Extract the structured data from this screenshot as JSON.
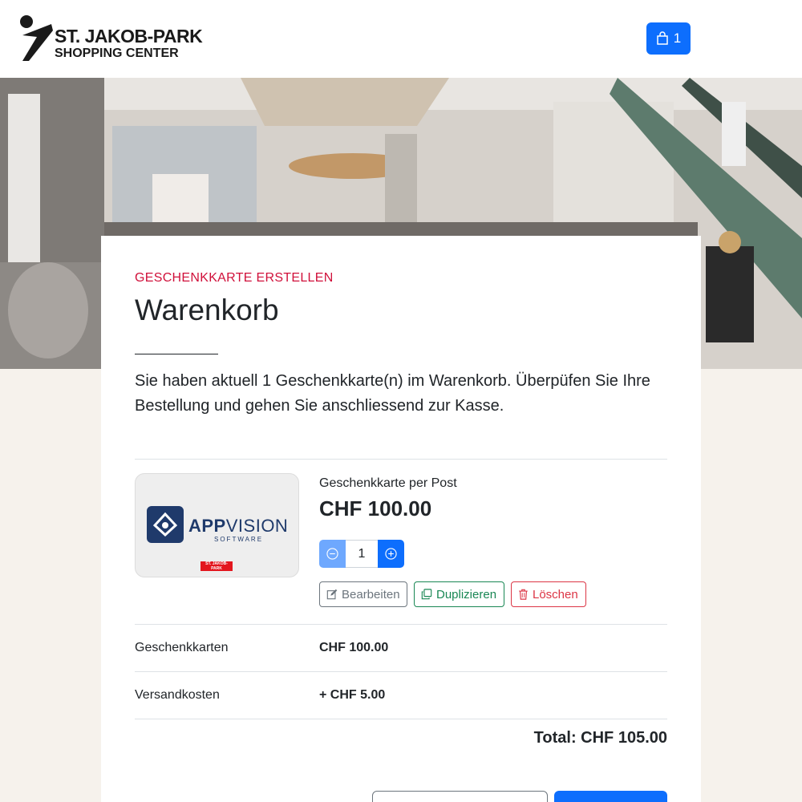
{
  "header": {
    "logo_line1": "ST. JAKOB-PARK",
    "logo_line2": "SHOPPING CENTER",
    "cart_icon": "shopping-bag-icon",
    "cart_count": "1"
  },
  "page": {
    "eyebrow": "GESCHENKKARTE ERSTELLEN",
    "title": "Warenkorb",
    "intro": "Sie haben aktuell 1 Geschenkkarte(n) im Warenkorb. Überpüfen Sie Ihre Bestellung und gehen Sie anschliessend zur Kasse."
  },
  "item": {
    "thumb_brand": "APP",
    "thumb_brand_thin": "VISION",
    "thumb_sub": "SOFTWARE",
    "thumb_badge": "ST. JAKOB-PARK",
    "name": "Geschenkkarte per Post",
    "price": "CHF 100.00",
    "quantity": "1",
    "edit_label": "Bearbeiten",
    "duplicate_label": "Duplizieren",
    "delete_label": "Löschen"
  },
  "summary": {
    "giftcards_label": "Geschenkkarten",
    "giftcards_value": "CHF 100.00",
    "shipping_label": "Versandkosten",
    "shipping_value": "+ CHF 5.00",
    "total": "Total: CHF 105.00"
  },
  "colors": {
    "primary": "#0d6efd",
    "accent_red": "#d0103a",
    "success": "#198754",
    "danger": "#dc3545",
    "secondary": "#6c757d",
    "page_bg": "#f6f2ec"
  }
}
